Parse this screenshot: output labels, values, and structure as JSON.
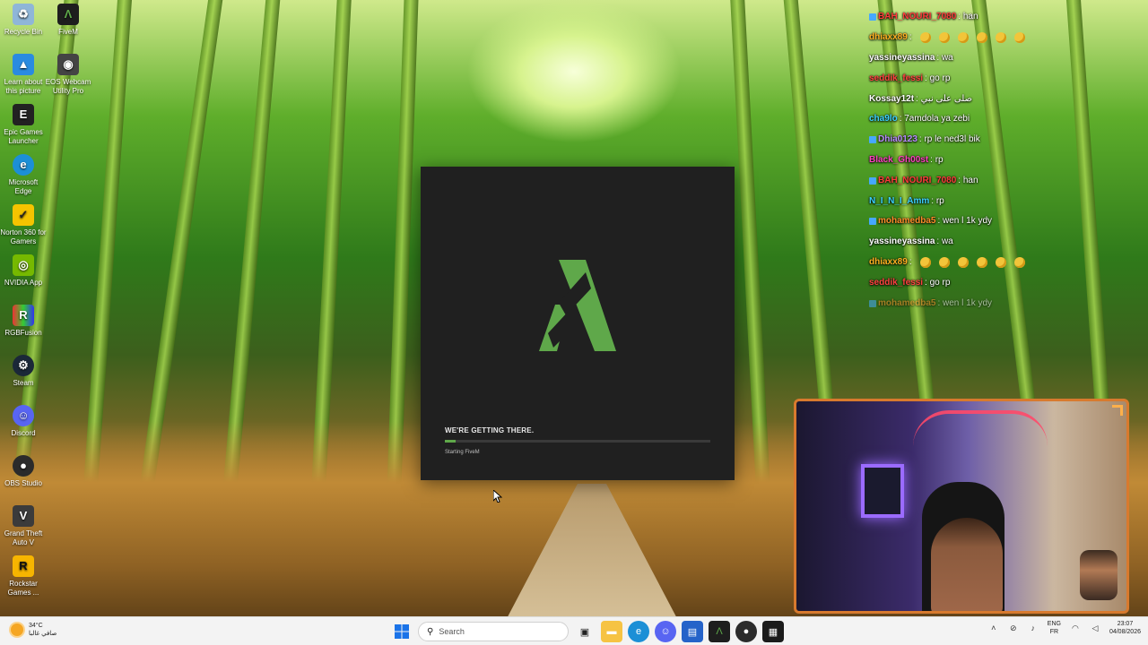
{
  "desktop": {
    "icons": [
      {
        "label": "Recycle Bin",
        "glyph": "recycle-bin-icon"
      },
      {
        "label": "FiveM",
        "glyph": "fivem-icon"
      },
      {
        "label": "Learn about this picture",
        "glyph": "learn-picture-icon"
      },
      {
        "label": "EOS Webcam Utility Pro",
        "glyph": "webcam-icon"
      },
      {
        "label": "Epic Games Launcher",
        "glyph": "epic-games-icon"
      },
      {
        "label": "Microsoft Edge",
        "glyph": "edge-icon"
      },
      {
        "label": "Norton 360 for Gamers",
        "glyph": "norton-icon"
      },
      {
        "label": "NVIDIA App",
        "glyph": "nvidia-icon"
      },
      {
        "label": "RGBFusion",
        "glyph": "rgb-fusion-icon"
      },
      {
        "label": "Steam",
        "glyph": "steam-icon"
      },
      {
        "label": "Discord",
        "glyph": "discord-icon"
      },
      {
        "label": "OBS Studio",
        "glyph": "obs-icon"
      },
      {
        "label": "Grand Theft Auto V",
        "glyph": "gta-icon"
      },
      {
        "label": "Rockstar Games ...",
        "glyph": "rockstar-icon"
      }
    ]
  },
  "fivem": {
    "loading_title": "WE'RE GETTING THERE.",
    "status": "Starting FiveM",
    "progress": 0.04,
    "accent": "#5fa84a"
  },
  "chat": {
    "messages": [
      {
        "user": "BAH_NOURI_7080",
        "text": " : han",
        "color": "#ff3b3b",
        "badge": true,
        "emotes": 0
      },
      {
        "user": "dhiaxx89",
        "text": " :",
        "color": "#ffb020",
        "badge": false,
        "emotes": 6
      },
      {
        "user": "yassineyassina",
        "text": " : wa",
        "color": "#ffffff",
        "badge": false,
        "emotes": 0
      },
      {
        "user": "seddik_fessi",
        "text": " : go rp",
        "color": "#ff4040",
        "badge": false,
        "emotes": 0
      },
      {
        "user": "Kossay12t",
        "text": " : صلى على نبي",
        "color": "#ffffff",
        "badge": false,
        "emotes": 0
      },
      {
        "user": "cha9lo",
        "text": " : 7amdola ya zebi",
        "color": "#3ad1ff",
        "badge": false,
        "emotes": 0
      },
      {
        "user": "Dhia0123",
        "text": " : rp le ned3l bik",
        "color": "#b98cff",
        "badge": true,
        "emotes": 0
      },
      {
        "user": "Black_Gh00st",
        "text": " : rp",
        "color": "#ff3fc0",
        "badge": false,
        "emotes": 0
      },
      {
        "user": "BAH_NOURI_7080",
        "text": " : han",
        "color": "#ff3b3b",
        "badge": true,
        "emotes": 0
      },
      {
        "user": "N_I_N_I_Amm",
        "text": " : rp",
        "color": "#3ad1ff",
        "badge": false,
        "emotes": 0
      },
      {
        "user": "mohamedba5",
        "text": " : wen l 1k ydy",
        "color": "#ff8c2a",
        "badge": true,
        "emotes": 0
      },
      {
        "user": "yassineyassina",
        "text": " : wa",
        "color": "#ffffff",
        "badge": false,
        "emotes": 0
      },
      {
        "user": "dhiaxx89",
        "text": " :",
        "color": "#ffb020",
        "badge": false,
        "emotes": 6
      },
      {
        "user": "seddik_fessi",
        "text": " : go rp",
        "color": "#ff4040",
        "badge": false,
        "emotes": 0
      },
      {
        "user": "mohamedba5",
        "text": " : wen l 1k ydy",
        "color": "#ff8c2a",
        "badge": true,
        "emotes": 0,
        "faded": true
      }
    ]
  },
  "taskbar": {
    "weather_temp": "34°C",
    "weather_text": "صافي غالبا",
    "search_placeholder": "Search",
    "lang_top": "ENG",
    "lang_bottom": "FR",
    "time": "23:07",
    "date": "04/08/2026"
  }
}
